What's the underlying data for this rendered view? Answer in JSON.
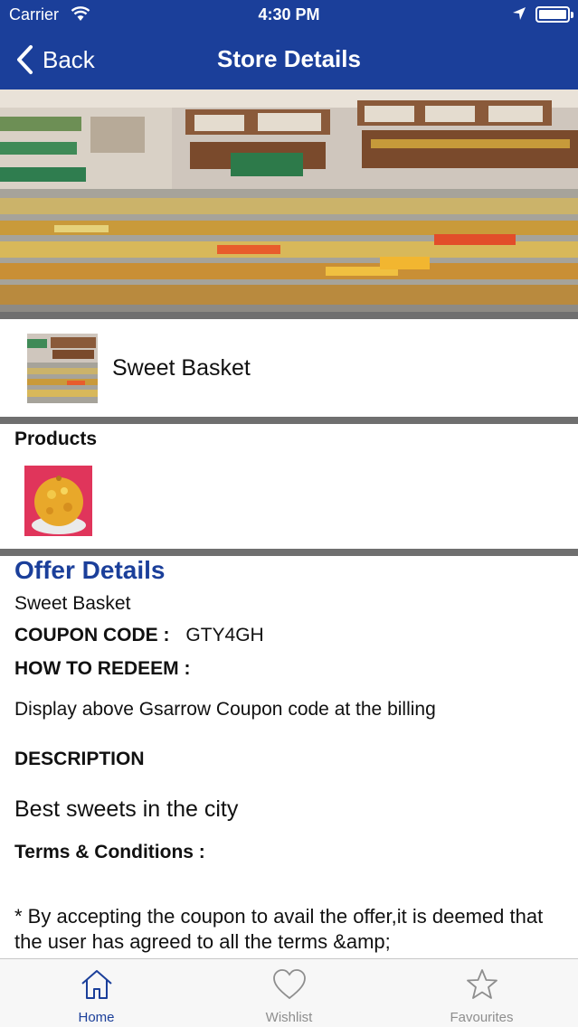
{
  "status_bar": {
    "carrier": "Carrier",
    "time": "4:30 PM"
  },
  "nav": {
    "back_label": "Back",
    "title": "Store Details"
  },
  "store": {
    "name": "Sweet Basket"
  },
  "products": {
    "label": "Products"
  },
  "offer": {
    "title": "Offer Details",
    "store_name": "Sweet Basket",
    "coupon_label": "COUPON CODE :",
    "coupon_code": "GTY4GH",
    "redeem_label": "HOW TO REDEEM :",
    "redeem_text": "Display above Gsarrow Coupon code at the billing",
    "description_label": "DESCRIPTION",
    "description_text": "Best sweets in the city",
    "terms_label": "Terms & Conditions :",
    "terms_text": "* By accepting the coupon to avail the offer,it is deemed that the user has agreed to all the terms &amp;"
  },
  "tabs": [
    {
      "label": "Home",
      "icon": "home-icon",
      "active": true
    },
    {
      "label": "Wishlist",
      "icon": "heart-icon",
      "active": false
    },
    {
      "label": "Favourites",
      "icon": "star-icon",
      "active": false
    }
  ],
  "colors": {
    "nav_bar": "#1b3f9a",
    "accent": "#1b3f9a",
    "separator": "#6f6f6f",
    "tab_inactive": "#8e8e8e"
  }
}
